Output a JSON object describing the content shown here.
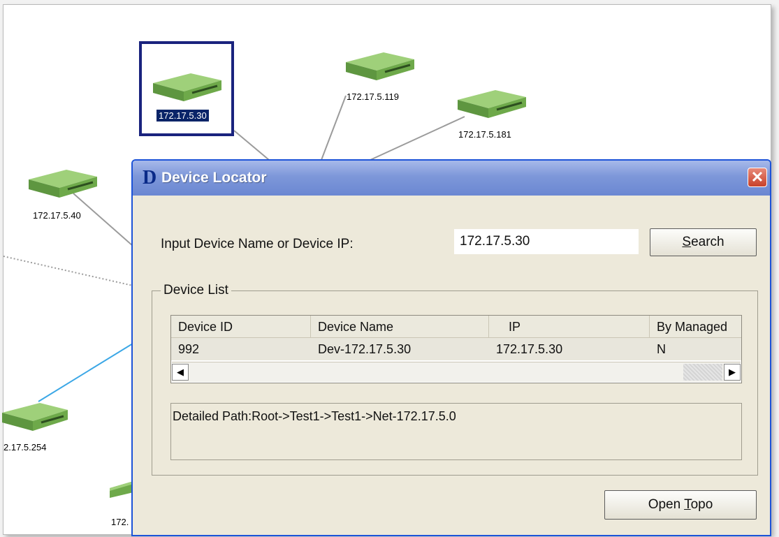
{
  "topology": {
    "devices": [
      {
        "id": "dev-1",
        "label": "172.17.5.30",
        "selected": true
      },
      {
        "id": "dev-2",
        "label": "172.17.5.119"
      },
      {
        "id": "dev-3",
        "label": "172.17.5.181"
      },
      {
        "id": "dev-4",
        "label": "172.17.5.40"
      },
      {
        "id": "dev-5",
        "label": "2.17.5.254"
      },
      {
        "id": "dev-6",
        "label": "172."
      }
    ],
    "colors": {
      "link": "#9b9b9b",
      "link_highlight": "#3ba7e6",
      "device_body": "#7fb35a",
      "selection": "#1a237e"
    }
  },
  "dialog": {
    "logo": "D",
    "title": "Device Locator",
    "close_icon": "close-icon",
    "input_label": "Input Device Name or Device IP:",
    "search_value": "172.17.5.30",
    "search_button": {
      "pre": "",
      "mnemonic": "S",
      "post": "earch"
    },
    "group_title": "Device List",
    "columns": [
      "Device ID",
      "Device Name",
      "IP",
      "By Managed"
    ],
    "rows": [
      {
        "device_id": "992",
        "device_name": "Dev-172.17.5.30",
        "ip": "172.17.5.30",
        "by_managed": "N"
      }
    ],
    "scroll_left_icon": "◀",
    "scroll_right_icon": "▶",
    "detailed_path": "Detailed Path:Root->Test1->Test1->Net-172.17.5.0",
    "open_topo_button": {
      "pre": "Open ",
      "mnemonic": "T",
      "post": "opo"
    }
  }
}
